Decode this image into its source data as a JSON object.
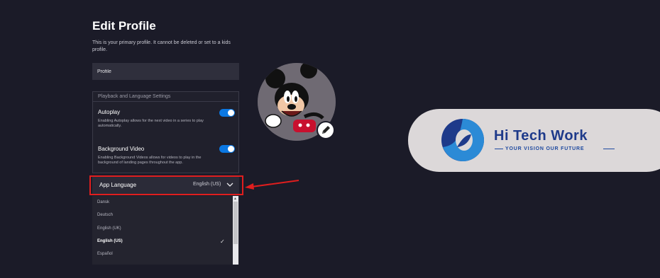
{
  "page": {
    "title": "Edit Profile",
    "subtitle": "This is your primary profile. It cannot be deleted or set to a kids profile."
  },
  "profile": {
    "name_value": "Profile"
  },
  "settings": {
    "header": "Playback and Language Settings",
    "autoplay": {
      "title": "Autoplay",
      "description": "Enabling Autoplay allows for the next video in a series to play automatically.",
      "enabled": true
    },
    "background_video": {
      "title": "Background Video",
      "description": "Enabling Background Videos allows for videos to play in the background of landing pages throughout the app.",
      "enabled": true
    }
  },
  "app_language": {
    "label": "App Language",
    "value": "English (US)",
    "options": [
      "Dansk",
      "Deutsch",
      "English (UK)",
      "English (US)",
      "Español"
    ],
    "selected_index": 3
  },
  "logo": {
    "title": "Hi Tech Work",
    "tagline": "YOUR VISION OUR FUTURE"
  },
  "colors": {
    "background": "#1b1b28",
    "toggle_on": "#0b78e3",
    "highlight": "#e01e1e",
    "logo_blue": "#1e3a8a"
  },
  "icons": {
    "avatar": "mickey-mouse-avatar",
    "edit": "pencil-icon",
    "dropdown": "chevron-down-icon",
    "selected": "checkmark-icon"
  }
}
